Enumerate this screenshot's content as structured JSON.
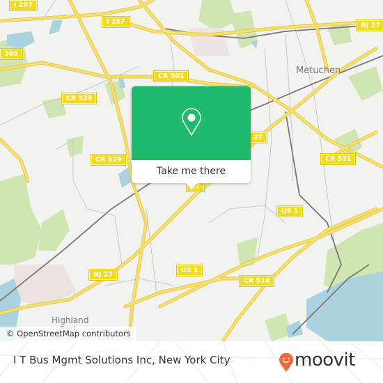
{
  "map": {
    "attribution": "© OpenStreetMap contributors",
    "road_shields": [
      {
        "label": "I 287",
        "id": "i287-top-left"
      },
      {
        "label": "I 287",
        "id": "i287-top"
      },
      {
        "label": "NJ 27",
        "id": "nj27-top-right"
      },
      {
        "label": "565",
        "id": "cr565-left"
      },
      {
        "label": "CR 501",
        "id": "cr501"
      },
      {
        "label": "CR 529",
        "id": "cr529-upper"
      },
      {
        "label": "CR 529",
        "id": "cr529-lower"
      },
      {
        "label": "27",
        "id": "nj27-center"
      },
      {
        "label": "27",
        "id": "nj27-right"
      },
      {
        "label": "CR 531",
        "id": "cr531"
      },
      {
        "label": "US 1",
        "id": "us1-right"
      },
      {
        "label": "US 1",
        "id": "us1-center"
      },
      {
        "label": "NJ 27",
        "id": "nj27-lower"
      },
      {
        "label": "CR 514",
        "id": "cr514"
      }
    ],
    "places": [
      {
        "label": "Metuchen",
        "id": "metuchen"
      },
      {
        "label": "Highland",
        "id": "highland-park-1"
      },
      {
        "label": "Park",
        "id": "highland-park-2"
      }
    ],
    "colors": {
      "background": "#f2f2ee",
      "road": "#f5dc5a",
      "water": "#aad3df",
      "park": "#c8e6a8",
      "rail": "#707070"
    }
  },
  "popup": {
    "icon": "location-pin-icon",
    "cta_label": "Take me there",
    "color": "#1fba6b"
  },
  "footer": {
    "place_title": "I T Bus Mgmt Solutions Inc, New York City",
    "brand": "moovit",
    "brand_color": "#f2683a"
  }
}
